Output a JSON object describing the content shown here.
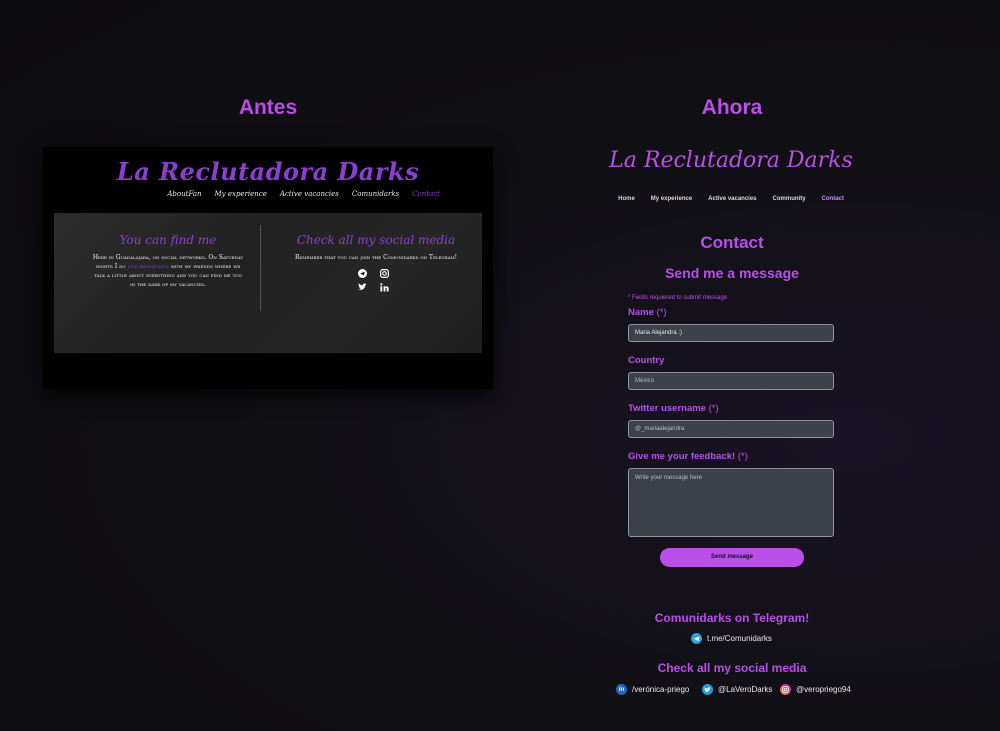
{
  "headings": {
    "before": "Antes",
    "now": "Ahora"
  },
  "before": {
    "logo": "La Reclutadora Darks",
    "nav": [
      "AboutFan",
      "My experience",
      "Active vacancies",
      "Comunidarks",
      "Contact"
    ],
    "col1_title": "You can find me",
    "col1_text_a": "Here in Guadalajara, on social networks. On Saturday nights I do",
    "col1_link": "live broadcasts",
    "col1_text_b": "with my friends where we talk a little about everything and you can find me too in the dark of my vacancies.",
    "col2_title": "Check all my social media",
    "col2_text": "Remember that you can join the Comunidarks on Telegram!"
  },
  "now": {
    "logo": "La Reclutadora Darks",
    "nav": [
      "Home",
      "My experience",
      "Active vacancies",
      "Community",
      "Contact"
    ],
    "contact_title": "Contact",
    "form_title": "Send me a message",
    "required_note": "* Fields requiered to submit message",
    "fields": {
      "name_label": "Name",
      "name_req": "(*)",
      "name_value": "Maria Alejandra :)",
      "country_label": "Country",
      "country_placeholder": "México",
      "twitter_label": "Twitter username",
      "twitter_req": "(*)",
      "twitter_placeholder": "@_mariaalejandra",
      "feedback_label": "Give me your feedback!",
      "feedback_req": "(*)",
      "feedback_placeholder": "Write your message here"
    },
    "send_label": "Send message",
    "telegram_title": "Comunidarks on Telegram!",
    "telegram_link": "t.me/Comunidarks",
    "social_title": "Check all my social media",
    "social": {
      "linkedin": "/verónica-priego",
      "twitter": "@LaVeroDarks",
      "instagram": "@veropriego94"
    }
  },
  "colors": {
    "accent": "#b94fe8",
    "field_bg": "#3d424a",
    "field_border": "#8e96a3"
  }
}
